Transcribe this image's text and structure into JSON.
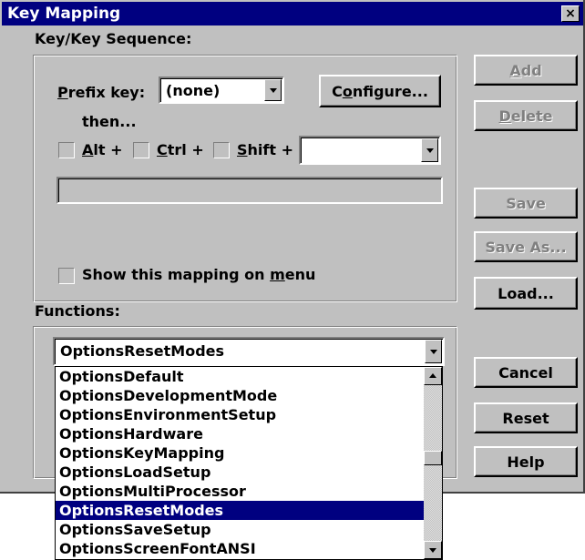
{
  "window": {
    "title": "Key Mapping",
    "close_glyph": "×"
  },
  "key_sequence": {
    "group_label": "Key/Key Sequence:",
    "prefix_label_mnemonic": "P",
    "prefix_label_rest": "refix key:",
    "prefix_value": "(none)",
    "configure_mnemonic": "o",
    "configure_pre": "C",
    "configure_post": "nfigure...",
    "then_label": "then...",
    "alt_mnemonic": "A",
    "alt_rest": "lt +",
    "alt_checked": false,
    "ctrl_mnemonic": "C",
    "ctrl_rest": "trl +",
    "ctrl_checked": false,
    "shift_mnemonic": "S",
    "shift_rest": "hift +",
    "shift_checked": false,
    "key_value": "",
    "sequence_text": "",
    "show_on_menu_pre": "Show this mapping on ",
    "show_on_menu_mnemonic": "m",
    "show_on_menu_post": "enu",
    "show_on_menu_checked": false
  },
  "functions": {
    "group_label": "Functions:",
    "selected": "OptionsResetModes",
    "list_items": [
      "OptionsDefault",
      "OptionsDevelopmentMode",
      "OptionsEnvironmentSetup",
      "OptionsHardware",
      "OptionsKeyMapping",
      "OptionsLoadSetup",
      "OptionsMultiProcessor",
      "OptionsResetModes",
      "OptionsSaveSetup",
      "OptionsScreenFontANSI"
    ],
    "selected_index": 7
  },
  "buttons": {
    "add_mnemonic": "A",
    "add_rest": "dd",
    "add_enabled": false,
    "delete_mnemonic": "D",
    "delete_rest": "elete",
    "delete_enabled": false,
    "save": "Save",
    "save_enabled": false,
    "save_as": "Save As...",
    "save_as_enabled": false,
    "load": "Load...",
    "cancel": "Cancel",
    "reset": "Reset",
    "help": "Help"
  },
  "colors": {
    "face": "#c0c0c0",
    "title_bar": "#000080",
    "selection": "#000080",
    "disabled_text": "#808080"
  }
}
